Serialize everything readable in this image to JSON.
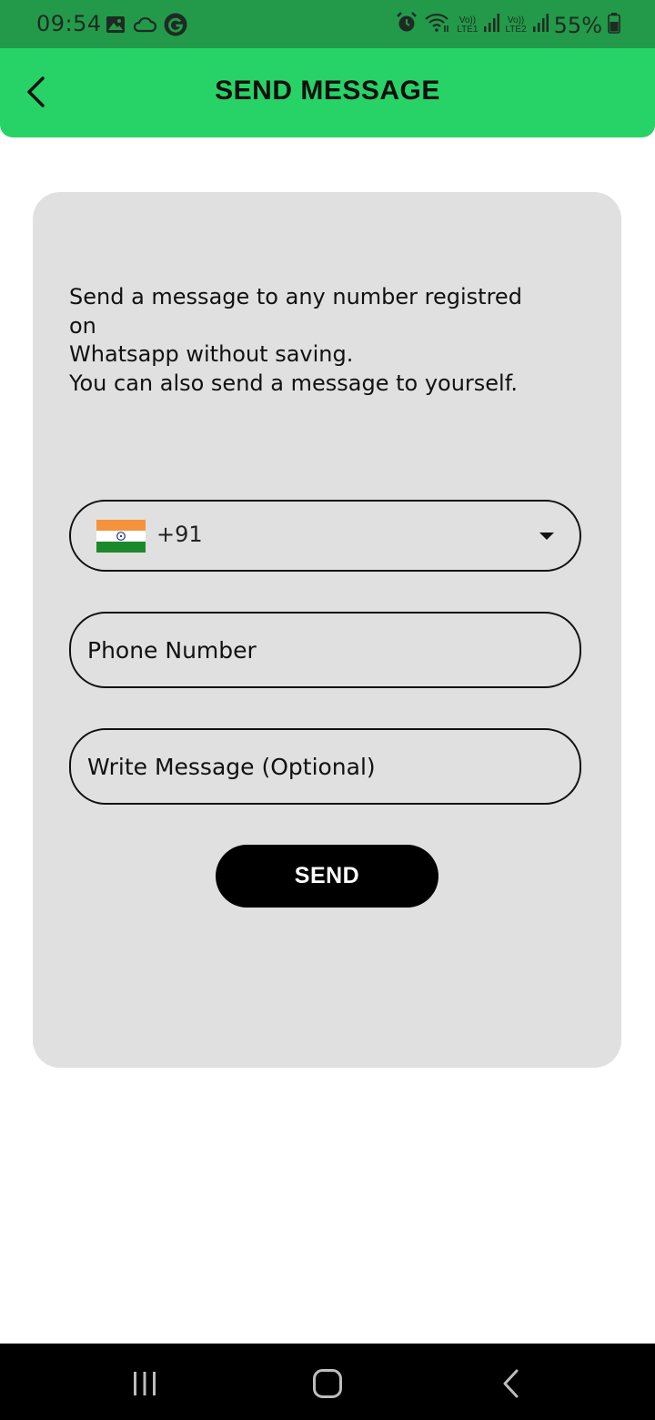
{
  "status_bar": {
    "time": "09:54",
    "battery": "55%",
    "left_icons": [
      "gallery-icon",
      "cloud-icon",
      "g-badge-icon"
    ],
    "right_icons": [
      "alarm-icon",
      "wifi-icon",
      "volte-lte1-icon",
      "signal-1-icon",
      "volte-lte2-icon",
      "signal-2-icon",
      "battery-icon"
    ],
    "volte1_top": "Vo))",
    "volte1_bottom": "LTE1",
    "volte2_top": "Vo))",
    "volte2_bottom": "LTE2"
  },
  "app_bar": {
    "title": "SEND MESSAGE",
    "back_icon": "back-arrow-icon",
    "color": "#27d366"
  },
  "card": {
    "intro_lines": [
      "Send a message to any number registred",
      "on",
      "Whatsapp without saving.",
      "You can also send a message to yourself."
    ]
  },
  "form": {
    "country_code": "+91",
    "country_flag": "india-flag-icon",
    "phone_placeholder": "Phone Number",
    "message_placeholder": "Write Message (Optional)",
    "send_label": "SEND"
  },
  "nav_bar": {
    "icons": [
      "recent-apps-icon",
      "home-icon",
      "back-icon"
    ]
  }
}
